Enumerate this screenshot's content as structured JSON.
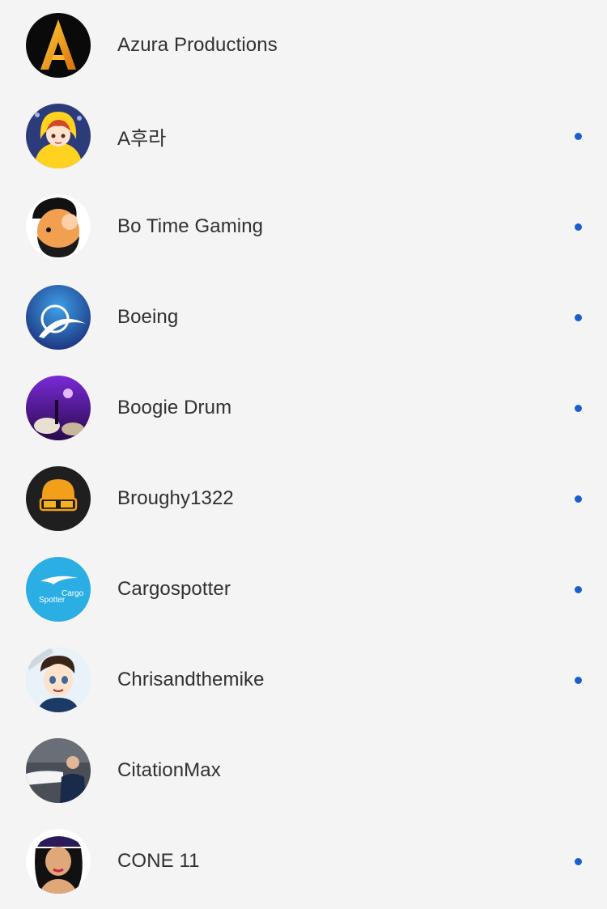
{
  "subscriptions": [
    {
      "name": "Azura Productions",
      "avatar_icon": "azura-logo-icon",
      "has_new": false
    },
    {
      "name": "A후라",
      "avatar_icon": "anime-girl-yellow-hoodie-icon",
      "has_new": true
    },
    {
      "name": "Bo Time Gaming",
      "avatar_icon": "bearded-man-cartoon-icon",
      "has_new": true
    },
    {
      "name": "Boeing",
      "avatar_icon": "boeing-logo-icon",
      "has_new": true
    },
    {
      "name": "Boogie Drum",
      "avatar_icon": "drum-stage-icon",
      "has_new": true
    },
    {
      "name": "Broughy1322",
      "avatar_icon": "glasses-character-icon",
      "has_new": true
    },
    {
      "name": "Cargospotter",
      "avatar_icon": "cargospotter-logo-icon",
      "has_new": true
    },
    {
      "name": "Chrisandthemike",
      "avatar_icon": "anime-pilot-icon",
      "has_new": true
    },
    {
      "name": "CitationMax",
      "avatar_icon": "pilot-with-jet-photo-icon",
      "has_new": false
    },
    {
      "name": "CONE 11",
      "avatar_icon": "woman-with-cap-icon",
      "has_new": true
    }
  ],
  "colors": {
    "background": "#f4f4f4",
    "text": "#303030",
    "new_indicator": "#1a5fd0"
  }
}
